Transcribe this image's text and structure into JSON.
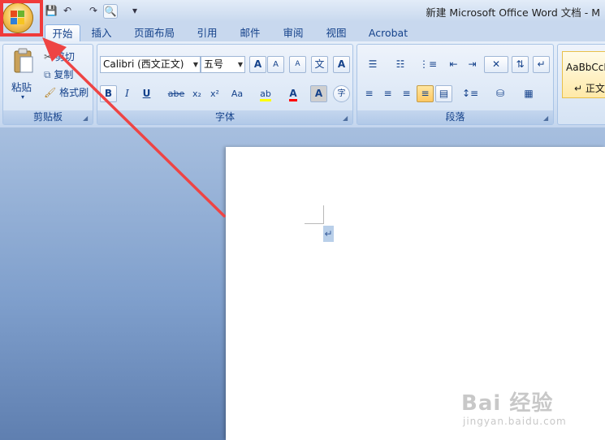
{
  "window": {
    "title": "新建 Microsoft Office Word 文档 - M"
  },
  "quick_access": {
    "save": "💾",
    "undo": "↶",
    "redo": "↷",
    "print_preview": "🔍",
    "more": "▾"
  },
  "tabs": [
    "开始",
    "插入",
    "页面布局",
    "引用",
    "邮件",
    "审阅",
    "视图",
    "Acrobat"
  ],
  "clipboard": {
    "paste_label": "粘贴",
    "cut_label": "剪切",
    "copy_label": "复制",
    "format_painter_label": "格式刷",
    "group_label": "剪贴板"
  },
  "font": {
    "font_name": "Calibri (西文正文)",
    "font_size": "五号",
    "grow": "A",
    "shrink": "A",
    "clear": "A",
    "phonetic": "文",
    "border": "A",
    "bold": "B",
    "italic": "I",
    "underline": "U",
    "strike": "abe",
    "subscript": "x₂",
    "superscript": "x²",
    "change_case": "Aa",
    "highlight": "ab",
    "font_color": "A",
    "shading": "A",
    "enclose": "字",
    "group_label": "字体"
  },
  "paragraph": {
    "group_label": "段落"
  },
  "styles": {
    "sample_text": "AaBbCcD",
    "normal": "↵ 正文"
  },
  "document": {
    "paragraph_mark": "↵"
  },
  "watermark": {
    "main": "Bai 经验",
    "sub": "jingyan.baidu.com"
  },
  "colors": {
    "highlight_box": "#f03a3a",
    "arrow": "#ee4444",
    "highlight_yellow": "#ffff00",
    "font_red": "#ff0000"
  }
}
